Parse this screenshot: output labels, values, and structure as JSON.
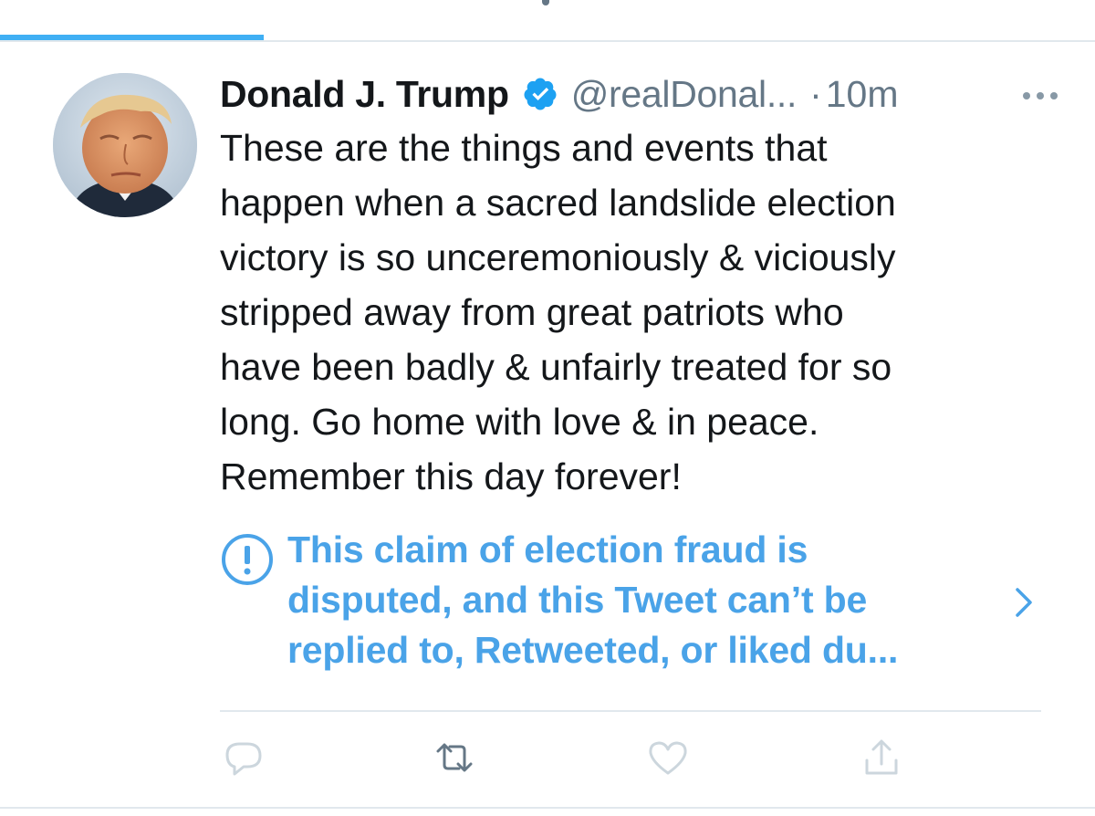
{
  "tweet": {
    "display_name": "Donald J. Trump",
    "handle": "@realDonal...",
    "separator": "·",
    "time": "10m",
    "verified_icon": "verified-badge-icon",
    "more_icon": "more-horizontal-icon",
    "text_lines": [
      "These are the things and events that",
      "happen when a sacred landslide election",
      "victory is so unceremoniously & viciously",
      "stripped away from great patriots who",
      "have been badly & unfairly treated for so",
      "long. Go home with love & in peace.",
      "Remember this day forever!"
    ],
    "notice": {
      "icon": "exclamation-circle-icon",
      "lines": [
        "This claim of election fraud is",
        "disputed, and this Tweet can’t be",
        "replied to, Retweeted, or liked du..."
      ],
      "chevron_icon": "chevron-right-icon"
    }
  },
  "actions": [
    {
      "name": "reply",
      "icon": "reply-icon"
    },
    {
      "name": "retweet",
      "icon": "retweet-icon"
    },
    {
      "name": "like",
      "icon": "heart-icon"
    },
    {
      "name": "share",
      "icon": "share-icon"
    }
  ],
  "colors": {
    "accent": "#1da1f2",
    "notice_text": "#4aa3e8",
    "secondary_text": "#657786",
    "disabled_icon": "#ccd6dd",
    "border": "#e1e8ed"
  }
}
